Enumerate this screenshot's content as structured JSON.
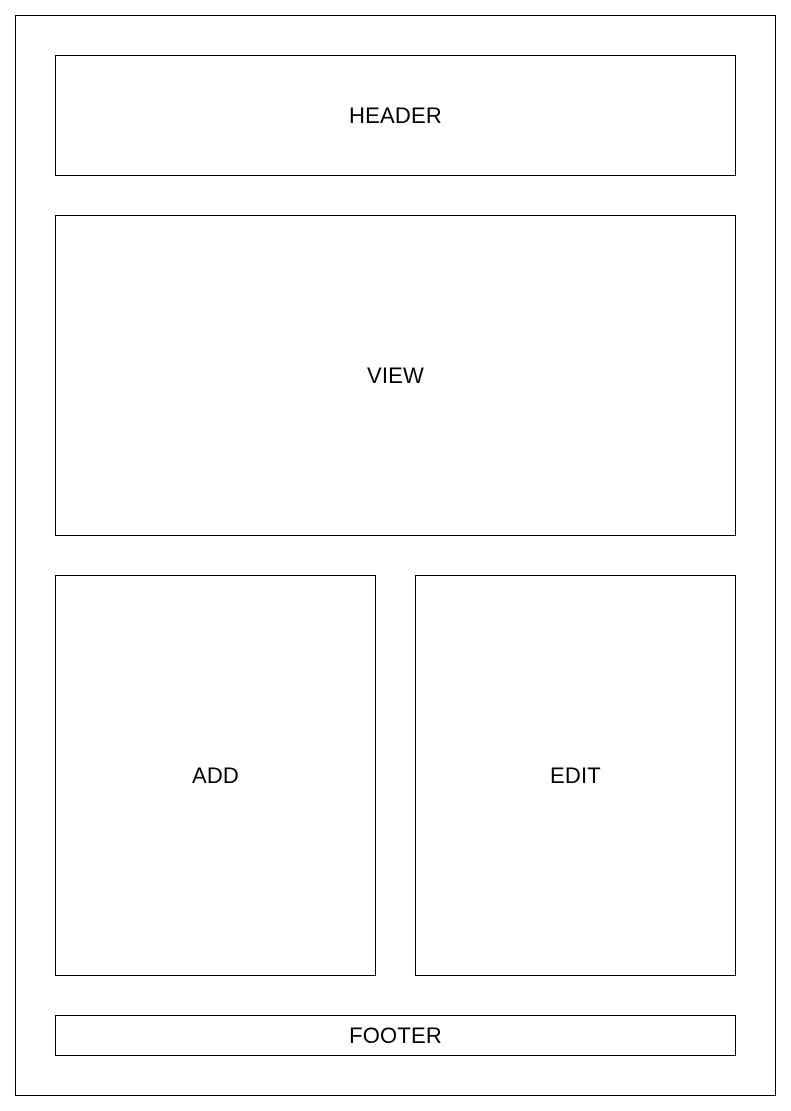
{
  "wireframe": {
    "header": {
      "label": "HEADER"
    },
    "view": {
      "label": "VIEW"
    },
    "add": {
      "label": "ADD"
    },
    "edit": {
      "label": "EDIT"
    },
    "footer": {
      "label": "FOOTER"
    }
  }
}
